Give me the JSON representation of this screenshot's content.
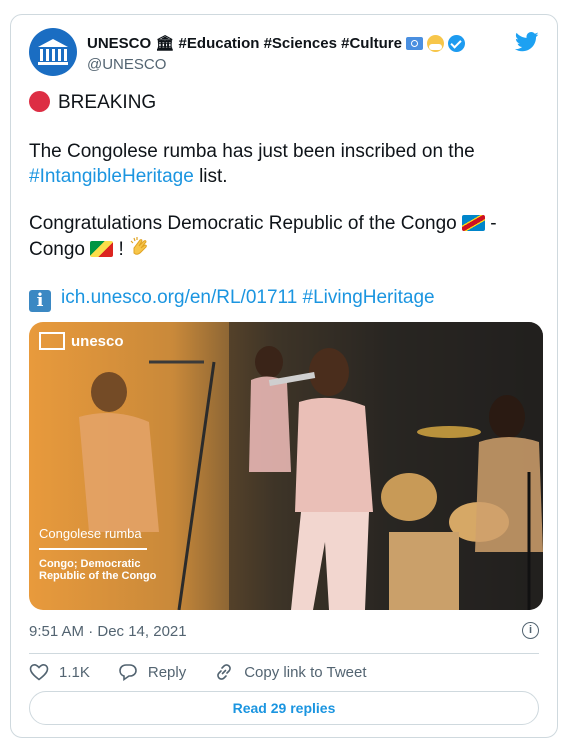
{
  "account": {
    "name": "UNESCO 🏛 #Education #Sciences #Culture",
    "handle": "@UNESCO"
  },
  "tweet": {
    "breaking": "BREAKING",
    "line1": "The Congolese rumba has just been inscribed on the",
    "hashtag1": "#IntangibleHeritage",
    "line2_suffix": " list.",
    "congrats": "Congratulations Democratic Republic of the Congo",
    "congrats_dash": " -",
    "congo": "Congo",
    "exclam": " ! ",
    "link": "ich.unesco.org/en/RL/01711",
    "hashtag2": "#LivingHeritage"
  },
  "media": {
    "badge": "unesco",
    "caption_title": "Congolese rumba",
    "caption_sub": "Congo; Democratic Republic of the Congo"
  },
  "footer": {
    "timestamp": "9:51 AM · Dec 14, 2021",
    "likes": "1.1K",
    "reply": "Reply",
    "copy": "Copy link to Tweet",
    "read": "Read 29 replies"
  },
  "colors": {
    "link": "#1b95e0",
    "brand": "#1da1f2"
  },
  "icons": [
    "unesco-logo-icon",
    "twitter-bird-icon",
    "verified-icon",
    "heart-icon",
    "reply-icon",
    "link-icon",
    "info-icon"
  ]
}
